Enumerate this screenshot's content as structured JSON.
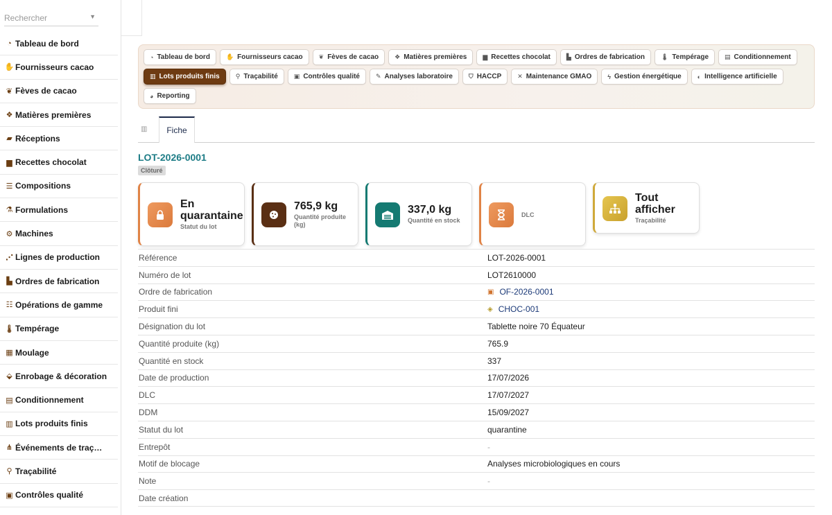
{
  "sidebar": {
    "search_placeholder": "Rechercher",
    "items": [
      {
        "label": "Tableau de bord",
        "icon": "gauge-icon"
      },
      {
        "label": "Fournisseurs cacao",
        "icon": "handshake-icon"
      },
      {
        "label": "Fèves de cacao",
        "icon": "seedling-icon"
      },
      {
        "label": "Matières premières",
        "icon": "cubes-icon"
      },
      {
        "label": "Réceptions",
        "icon": "truck-loading-icon"
      },
      {
        "label": "Recettes chocolat",
        "icon": "book-open-icon"
      },
      {
        "label": "Compositions",
        "icon": "list-icon"
      },
      {
        "label": "Formulations",
        "icon": "flask-icon"
      },
      {
        "label": "Machines",
        "icon": "cogs-icon"
      },
      {
        "label": "Lignes de production",
        "icon": "network-icon"
      },
      {
        "label": "Ordres de fabrication",
        "icon": "industry-icon"
      },
      {
        "label": "Opérations de gamme",
        "icon": "tasks-icon"
      },
      {
        "label": "Tempérage",
        "icon": "thermometer-icon"
      },
      {
        "label": "Moulage",
        "icon": "grid-icon"
      },
      {
        "label": "Enrobage & décoration",
        "icon": "fill-drip-icon"
      },
      {
        "label": "Conditionnement",
        "icon": "box-icon"
      },
      {
        "label": "Lots produits finis",
        "icon": "barcode-icon"
      },
      {
        "label": "Événements de traç…",
        "icon": "sitemap-icon"
      },
      {
        "label": "Traçabilité",
        "icon": "search-icon"
      },
      {
        "label": "Contrôles qualité",
        "icon": "clipboard-check-icon"
      }
    ]
  },
  "module_nav": [
    {
      "label": "Tableau de bord",
      "icon": "gauge-icon",
      "active": false
    },
    {
      "label": "Fournisseurs cacao",
      "icon": "handshake-icon",
      "active": false
    },
    {
      "label": "Fèves de cacao",
      "icon": "seedling-icon",
      "active": false
    },
    {
      "label": "Matières premières",
      "icon": "cubes-icon",
      "active": false
    },
    {
      "label": "Recettes chocolat",
      "icon": "book-open-icon",
      "active": false
    },
    {
      "label": "Ordres de fabrication",
      "icon": "industry-icon",
      "active": false
    },
    {
      "label": "Tempérage",
      "icon": "thermometer-icon",
      "active": false
    },
    {
      "label": "Conditionnement",
      "icon": "box-icon",
      "active": false
    },
    {
      "label": "Lots produits finis",
      "icon": "barcode-icon",
      "active": true
    },
    {
      "label": "Traçabilité",
      "icon": "search-icon",
      "active": false
    },
    {
      "label": "Contrôles qualité",
      "icon": "clipboard-check-icon",
      "active": false
    },
    {
      "label": "Analyses laboratoire",
      "icon": "vial-icon",
      "active": false
    },
    {
      "label": "HACCP",
      "icon": "shield-icon",
      "active": false
    },
    {
      "label": "Maintenance GMAO",
      "icon": "tools-icon",
      "active": false
    },
    {
      "label": "Gestion énergétique",
      "icon": "bolt-icon",
      "active": false
    },
    {
      "label": "Intelligence artificielle",
      "icon": "brain-icon",
      "active": false
    },
    {
      "label": "Reporting",
      "icon": "chart-pie-icon",
      "active": false
    }
  ],
  "tabs": {
    "fiche": "Fiche"
  },
  "record": {
    "title": "LOT-2026-0001",
    "status_badge": "Clôturé"
  },
  "cards": [
    {
      "value": "En quarantaine",
      "label": "Statut du lot",
      "icon": "lock-icon",
      "color": "#e08346"
    },
    {
      "value": "765,9 kg",
      "label": "Quantité produite (kg)",
      "icon": "cookie-icon",
      "color": "#5a2f14"
    },
    {
      "value": "337,0 kg",
      "label": "Quantité en stock",
      "icon": "warehouse-icon",
      "color": "#157a72"
    },
    {
      "value": "",
      "label": "DLC",
      "icon": "hourglass-icon",
      "color": "#e08346"
    },
    {
      "value": "Tout afficher",
      "label": "Traçabilité",
      "icon": "sitemap-icon",
      "color": "#cfa93a"
    }
  ],
  "fields": [
    {
      "key": "Référence",
      "value": "LOT-2026-0001"
    },
    {
      "key": "Numéro de lot",
      "value": "LOT2610000"
    },
    {
      "key": "Ordre de fabrication",
      "value": "OF-2026-0001",
      "link": true,
      "icon": "industry-icon"
    },
    {
      "key": "Produit fini",
      "value": "CHOC-001",
      "link": true,
      "icon": "cube-icon"
    },
    {
      "key": "Désignation du lot",
      "value": "Tablette noire 70 Équateur"
    },
    {
      "key": "Quantité produite (kg)",
      "value": "765.9"
    },
    {
      "key": "Quantité en stock",
      "value": "337"
    },
    {
      "key": "Date de production",
      "value": "17/07/2026"
    },
    {
      "key": "DLC",
      "value": "17/07/2027"
    },
    {
      "key": "DDM",
      "value": "15/09/2027"
    },
    {
      "key": "Statut du lot",
      "value": "quarantine"
    },
    {
      "key": "Entrepôt",
      "value": "-"
    },
    {
      "key": "Motif de blocage",
      "value": "Analyses microbiologiques en cours"
    },
    {
      "key": "Note",
      "value": "-"
    },
    {
      "key": "Date création",
      "value": ""
    }
  ],
  "colors": {
    "accent": "#6e3b12",
    "title": "#1d7c86",
    "link": "#1c3a78"
  }
}
